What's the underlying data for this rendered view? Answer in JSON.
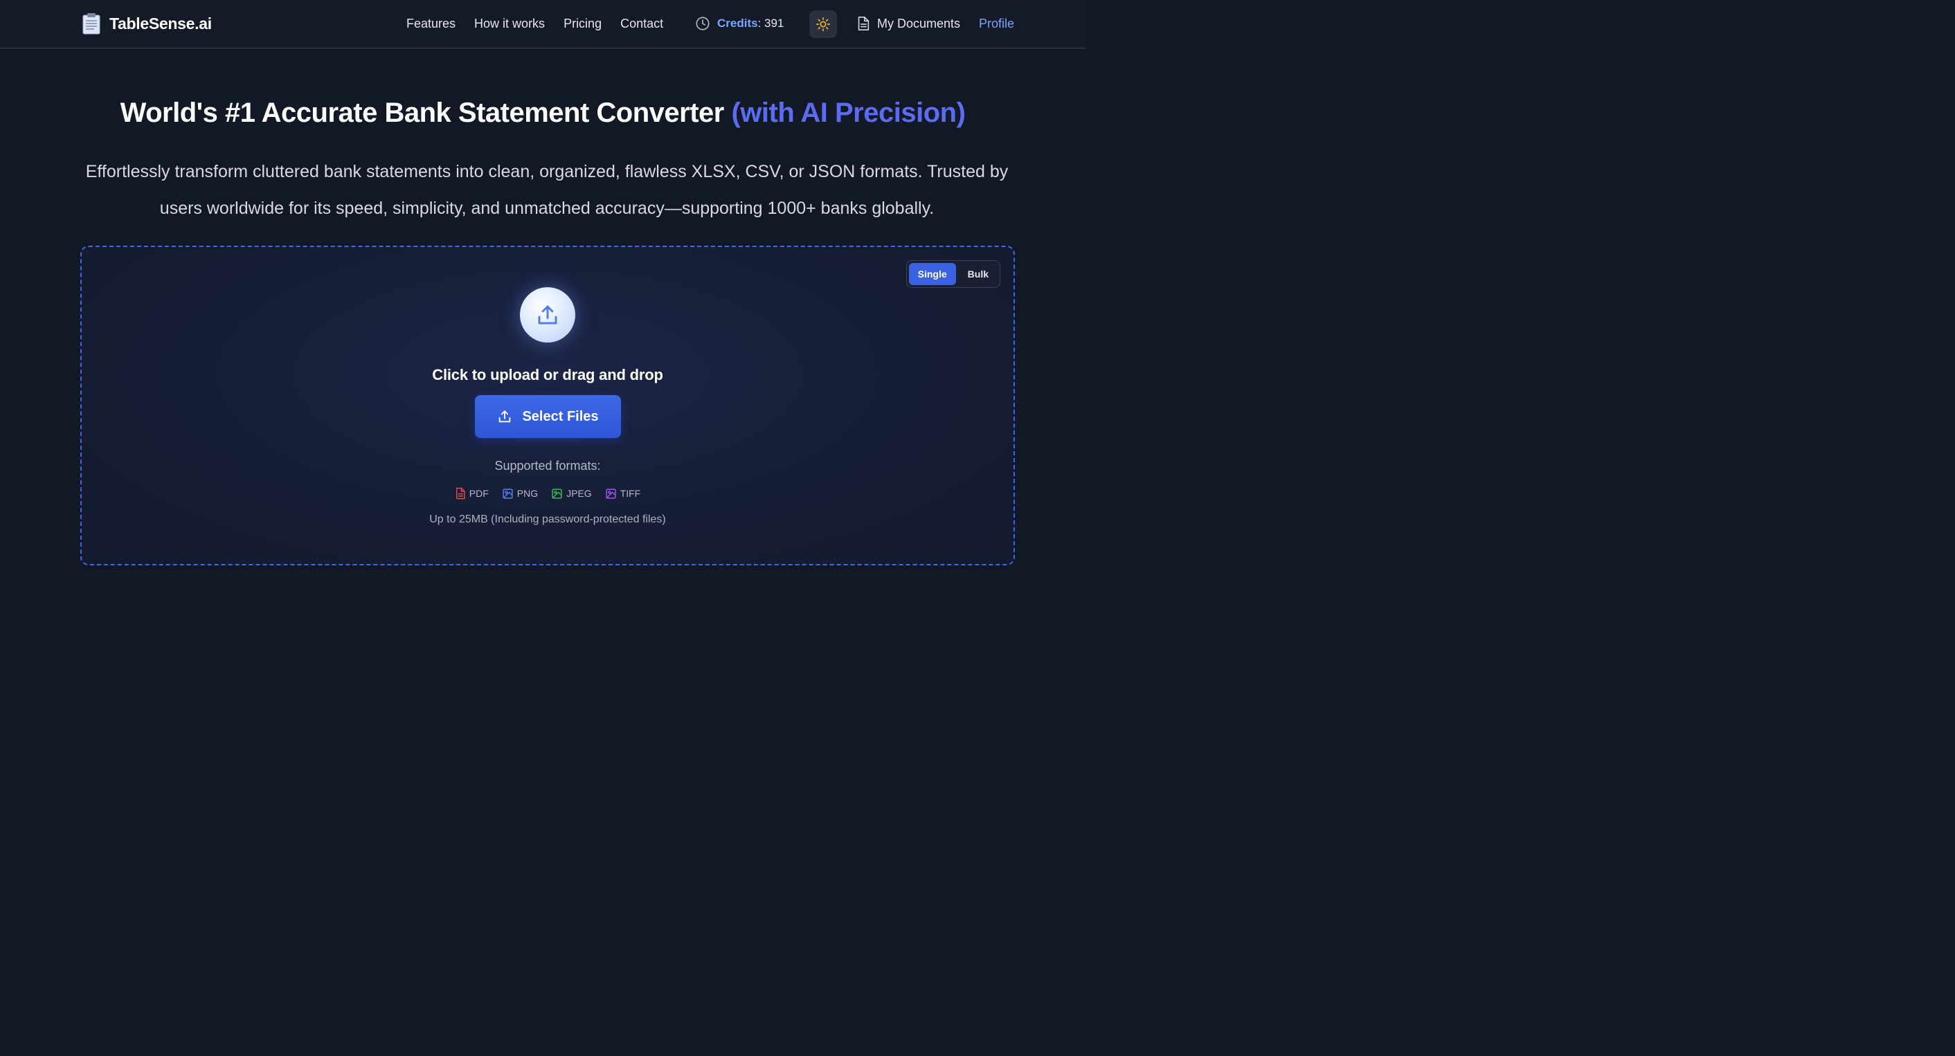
{
  "nav": {
    "brand": "TableSense.ai",
    "links": [
      {
        "label": "Features"
      },
      {
        "label": "How it works"
      },
      {
        "label": "Pricing"
      },
      {
        "label": "Contact"
      }
    ],
    "credits_label": "Credits",
    "credits_value": ": 391",
    "my_documents": "My Documents",
    "profile": "Profile"
  },
  "hero": {
    "title_main": "World's #1 Accurate Bank Statement Converter ",
    "title_accent": "(with AI Precision)",
    "description": "Effortlessly transform cluttered bank statements into clean, organized, flawless XLSX, CSV, or JSON formats. Trusted by users worldwide for its speed, simplicity, and unmatched accuracy—supporting 1000+ banks globally."
  },
  "upload": {
    "modes": [
      {
        "label": "Single",
        "active": true
      },
      {
        "label": "Bulk",
        "active": false
      }
    ],
    "heading": "Click to upload or drag and drop",
    "select_button": "Select Files",
    "formats_title": "Supported formats:",
    "formats": [
      {
        "label": "PDF",
        "icon": "file-icon",
        "color": "#e5484d"
      },
      {
        "label": "PNG",
        "icon": "image-icon",
        "color": "#4f86f7"
      },
      {
        "label": "JPEG",
        "icon": "image-icon",
        "color": "#3fb950"
      },
      {
        "label": "TIFF",
        "icon": "image-icon",
        "color": "#a855f7"
      }
    ],
    "limit_note": "Up to 25MB (Including password-protected files)"
  },
  "colors": {
    "background": "#121826",
    "accent": "#5b6cf0",
    "link": "#7aa5ff",
    "primary_button": "#3b62e0",
    "dashed_border": "#3f67e6",
    "sun_icon": "#f5b731"
  }
}
